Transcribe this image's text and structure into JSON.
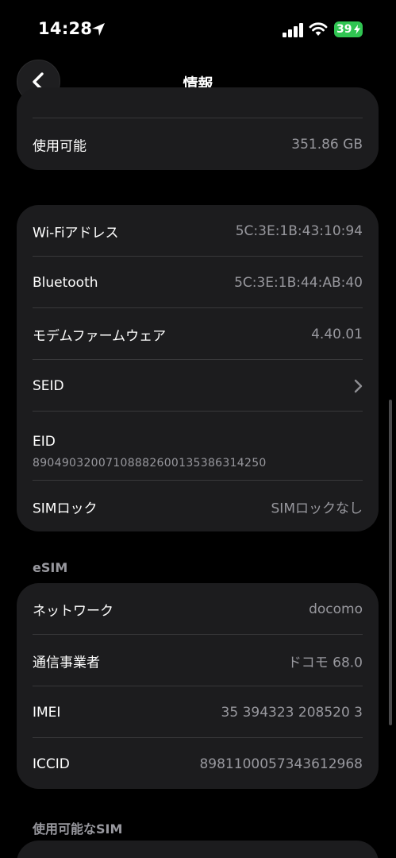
{
  "status_bar": {
    "time": "14:28",
    "battery": "39"
  },
  "nav": {
    "title": "情報"
  },
  "storage": {
    "available_label": "使用可能",
    "available_value": "351.86 GB"
  },
  "network_info": {
    "wifi_label": "Wi-Fiアドレス",
    "wifi_value": "5C:3E:1B:43:10:94",
    "bluetooth_label": "Bluetooth",
    "bluetooth_value": "5C:3E:1B:44:AB:40",
    "modem_label": "モデムファームウェア",
    "modem_value": "4.40.01",
    "seid_label": "SEID",
    "eid_label": "EID",
    "eid_value": "89049032007108882600135386314250",
    "simlock_label": "SIMロック",
    "simlock_value": "SIMロックなし"
  },
  "esim": {
    "header": "eSIM",
    "network_label": "ネットワーク",
    "network_value": "docomo",
    "carrier_label": "通信事業者",
    "carrier_value": "ドコモ 68.0",
    "imei_label": "IMEI",
    "imei_value": "35 394323 208520 3",
    "iccid_label": "ICCID",
    "iccid_value": "8981100057343612968"
  },
  "available_sim": {
    "header": "使用可能なSIM"
  },
  "colors": {
    "background": "#000000",
    "card": "#1c1c1e",
    "secondary_text": "#98989e",
    "battery": "#30c552"
  }
}
